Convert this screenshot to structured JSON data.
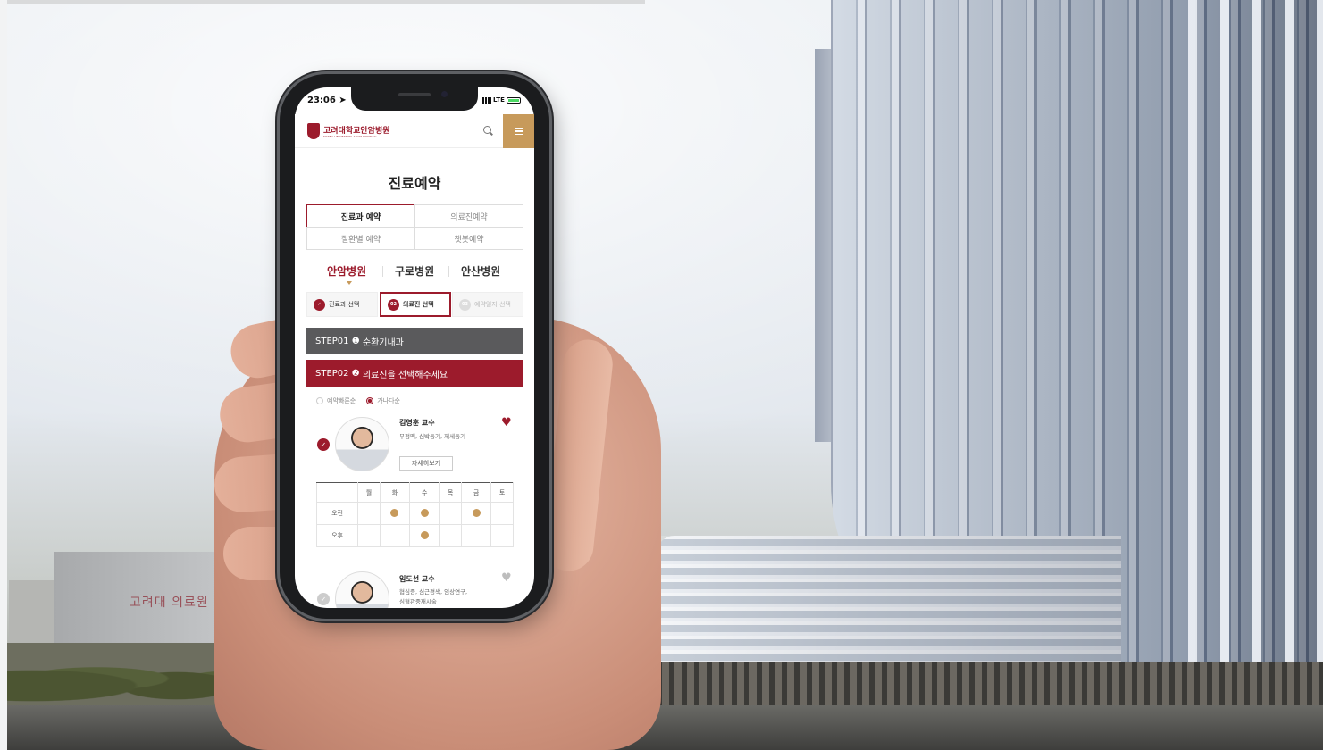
{
  "background": {
    "building_sign": "고려대 의료원",
    "colors": {
      "brand": "#9c1b2c",
      "accent": "#c79a5b",
      "step1_bar": "#5a5a5c"
    }
  },
  "status_bar": {
    "time": "23:06",
    "network": "LTE"
  },
  "app_header": {
    "logo_kor": "고려대학교안암병원",
    "logo_eng": "KOREA UNIVERSITY ANAM HOSPITAL",
    "search_icon": "search-icon",
    "menu_icon": "hamburger-menu-icon"
  },
  "page_title": "진료예약",
  "reservation_tabs": [
    {
      "label": "진료과 예약",
      "active": true
    },
    {
      "label": "의료진예약",
      "active": false
    },
    {
      "label": "질환별 예약",
      "active": false
    },
    {
      "label": "챗봇예약",
      "active": false
    }
  ],
  "hospitals": [
    {
      "label": "안암병원",
      "active": true
    },
    {
      "label": "구로병원",
      "active": false
    },
    {
      "label": "안산병원",
      "active": false
    }
  ],
  "steps": [
    {
      "num": "✓",
      "label": "진료과 선택",
      "state": "done"
    },
    {
      "num": "02",
      "label": "의료진 선택",
      "state": "current"
    },
    {
      "num": "03",
      "label": "예약일자 선택",
      "state": "todo"
    }
  ],
  "step1_bar": {
    "step": "STEP01",
    "text": "순환기내과"
  },
  "step2_bar": {
    "step": "STEP02",
    "text": "의료진을 선택해주세요"
  },
  "sort_options": {
    "fast": "예약빠른순",
    "alpha": "가나다순",
    "selected": "가나다순"
  },
  "doctors": [
    {
      "name": "김영훈 교수",
      "specialty": "부정맥, 심박동기, 제세동기",
      "selected": true,
      "favorite": true,
      "detail_button": "자세히보기"
    },
    {
      "name": "임도선 교수",
      "specialty_line1": "협심증, 심근경색, 임상연구,",
      "specialty_line2": "심혈관중재시술",
      "selected": false,
      "favorite": false
    }
  ],
  "schedule": {
    "days": [
      "월",
      "화",
      "수",
      "목",
      "금",
      "토"
    ],
    "rows": [
      {
        "label": "오전",
        "slots": [
          false,
          true,
          true,
          false,
          true,
          false
        ]
      },
      {
        "label": "오후",
        "slots": [
          false,
          false,
          true,
          false,
          false,
          false
        ]
      }
    ]
  }
}
